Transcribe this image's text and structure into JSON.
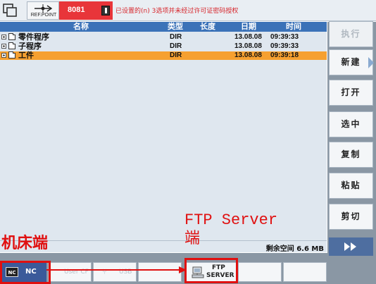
{
  "topbar": {
    "ref_label": "REF.POINT",
    "alarm_number": "8081",
    "alarm_text": "已设置的(n) 3选项并未经过许可证密码授权"
  },
  "list": {
    "columns": {
      "name": "名称",
      "type": "类型",
      "length": "长度",
      "date": "日期",
      "time": "时间"
    },
    "rows": [
      {
        "name": "零件程序",
        "type": "DIR",
        "date": "13.08.08",
        "time": "09:39:33",
        "selected": false
      },
      {
        "name": "子程序",
        "type": "DIR",
        "date": "13.08.08",
        "time": "09:39:33",
        "selected": false
      },
      {
        "name": "工件",
        "type": "DIR",
        "date": "13.08.08",
        "time": "09:39:18",
        "selected": true
      }
    ],
    "free_space": "剩余空间 6.6 MB"
  },
  "softkeys": {
    "execute": "执行",
    "new": "新建",
    "open": "打开",
    "select": "选中",
    "copy": "复制",
    "paste": "粘贴",
    "cut": "剪切"
  },
  "bottom": {
    "nc_icon": "NC",
    "nc_label": "NC",
    "user_label": "User CF",
    "usb_label": "USB",
    "ftp_line1": "FTP",
    "ftp_line2": "SERVER"
  },
  "annotations": {
    "machine_side": "机床端",
    "ftp_server_line1": "FTP Server",
    "ftp_server_line2": "端",
    "color": "#e01010"
  },
  "colors": {
    "header_blue": "#3b72b8",
    "selection_orange": "#f6a030",
    "alarm_red": "#e8353a"
  }
}
